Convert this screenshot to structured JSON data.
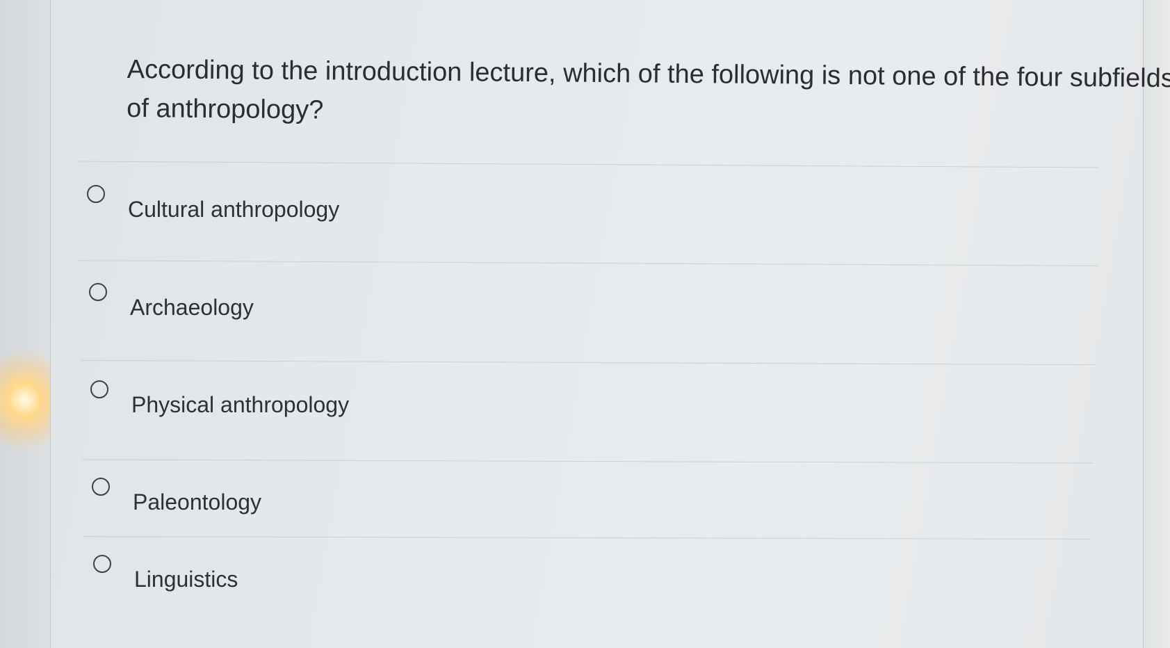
{
  "quiz": {
    "question": "According to the introduction lecture, which of the following is not one of the four subfields of anthropology?",
    "options": [
      {
        "label": "Cultural anthropology",
        "selected": false
      },
      {
        "label": "Archaeology",
        "selected": false
      },
      {
        "label": "Physical anthropology",
        "selected": false
      },
      {
        "label": "Paleontology",
        "selected": false
      },
      {
        "label": "Linguistics",
        "selected": false
      }
    ]
  },
  "colors": {
    "page_background": "#e6eaec",
    "text": "#2b2d30",
    "radio_border": "#3e4246",
    "divider": "#cbd0d3"
  }
}
